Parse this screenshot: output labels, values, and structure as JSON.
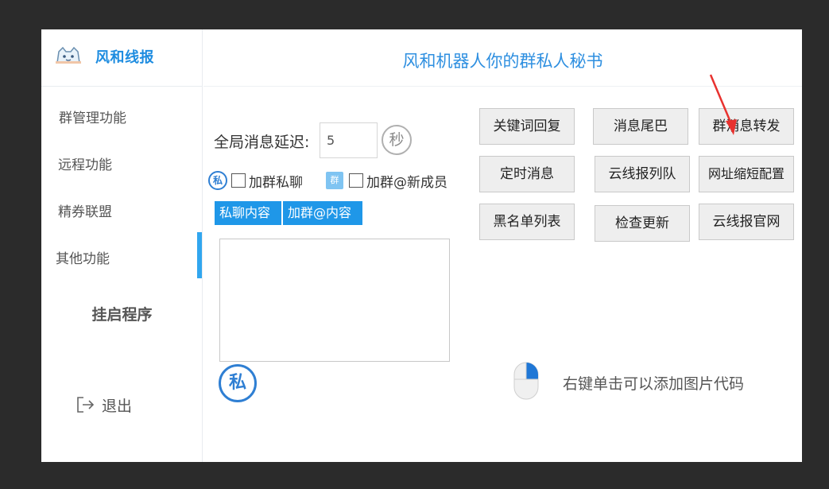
{
  "app": {
    "logo_text": "风和线报",
    "header_title": "风和机器人你的群私人秘书"
  },
  "sidebar": {
    "items": [
      {
        "label": "群管理功能"
      },
      {
        "label": "远程功能"
      },
      {
        "label": "精券联盟"
      },
      {
        "label": "其他功能"
      }
    ],
    "hang_label": "挂启程序",
    "logout_label": "退出"
  },
  "settings": {
    "delay_label": "全局消息延迟:",
    "delay_value": "5",
    "sec_label": "秒",
    "si_badge": "私",
    "qun_badge": "群",
    "check1_label": "加群私聊",
    "check2_label": "加群@新成员",
    "tabs": [
      "私聊内容",
      "加群@内容"
    ],
    "si_big": "私",
    "hint": "右键单击可以添加图片代码"
  },
  "buttons": [
    {
      "label": "关键词回复"
    },
    {
      "label": "消息尾巴"
    },
    {
      "label": "群消息转发"
    },
    {
      "label": "定时消息"
    },
    {
      "label": "云线报列队"
    },
    {
      "label": "网址缩短配置"
    },
    {
      "label": "黑名单列表"
    },
    {
      "label": "检查更新"
    },
    {
      "label": "云线报官网"
    }
  ],
  "colors": {
    "accent": "#1f97e8",
    "logo": "#1d8ce0",
    "arrow": "#e8322f"
  }
}
